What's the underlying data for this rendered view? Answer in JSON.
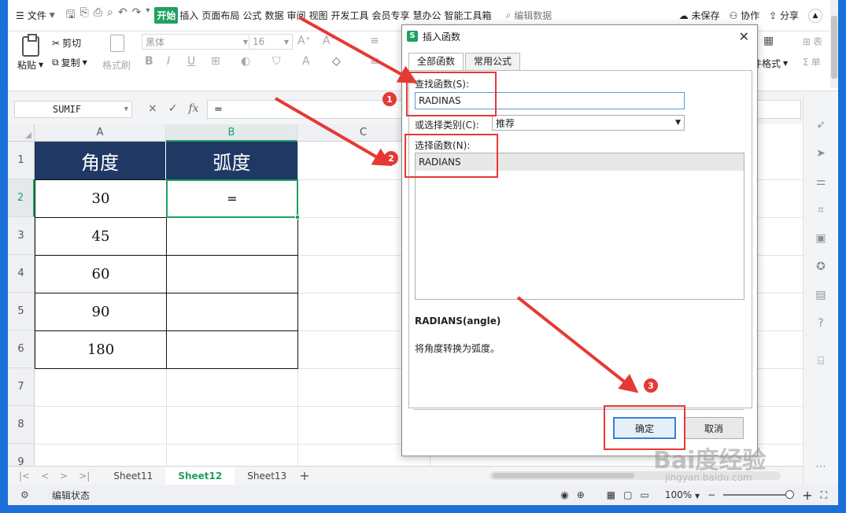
{
  "menubar": {
    "file": "文件",
    "tabs": [
      "开始",
      "插入",
      "页面布局",
      "公式",
      "数据",
      "审阅",
      "视图",
      "开发工具",
      "会员专享",
      "慧办公",
      "智能工具箱"
    ],
    "active_tab": "开始",
    "search": "编辑数据",
    "unsaved": "未保存",
    "collab": "协作",
    "share": "分享"
  },
  "ribbon": {
    "paste": "粘贴",
    "cut": "剪切",
    "copy": "复制",
    "format_painter": "格式刷",
    "font_name": "黑体",
    "font_size": "16",
    "bold": "B",
    "italic": "I",
    "underline": "U",
    "font_color": "A",
    "cond_format": "件格式",
    "right_label": "表",
    "right_label2": "单"
  },
  "formula_bar": {
    "name_box": "SUMIF",
    "cancel": "×",
    "confirm": "✓",
    "fx": "fx",
    "formula": "="
  },
  "sheet": {
    "columns": [
      "A",
      "B",
      "C"
    ],
    "active_column": "B",
    "rows": [
      "1",
      "2",
      "3",
      "4",
      "5",
      "6",
      "7",
      "8",
      "9"
    ],
    "active_row": "2",
    "header": [
      "角度",
      "弧度"
    ],
    "angles": [
      "30",
      "45",
      "60",
      "90",
      "180"
    ],
    "b2_value": "="
  },
  "sheet_tabs": {
    "tabs": [
      "Sheet11",
      "Sheet12",
      "Sheet13"
    ],
    "active": "Sheet12",
    "add": "+"
  },
  "status": {
    "mode": "编辑状态",
    "zoom": "100%",
    "minus": "−",
    "plus": "+"
  },
  "dialog": {
    "title": "插入函数",
    "tabs": [
      "全部函数",
      "常用公式"
    ],
    "active_tab": "全部函数",
    "search_label": "查找函数(S):",
    "search_value": "RADINAS",
    "category_label": "或选择类别(C):",
    "category_value": "推荐",
    "select_label": "选择函数(N):",
    "functions": [
      "RADIANS"
    ],
    "signature": "RADIANS(angle)",
    "description": "将角度转换为弧度。",
    "ok": "确定",
    "cancel": "取消"
  },
  "annotations": {
    "badges": [
      "1",
      "2",
      "3"
    ],
    "color": "#e53935"
  },
  "watermark": {
    "text": "Bai度经验",
    "url": "jingyan.baidu.com"
  },
  "colors": {
    "accent": "#1fa160",
    "header_fill": "#1f3864",
    "frame": "#1a6fd8"
  }
}
